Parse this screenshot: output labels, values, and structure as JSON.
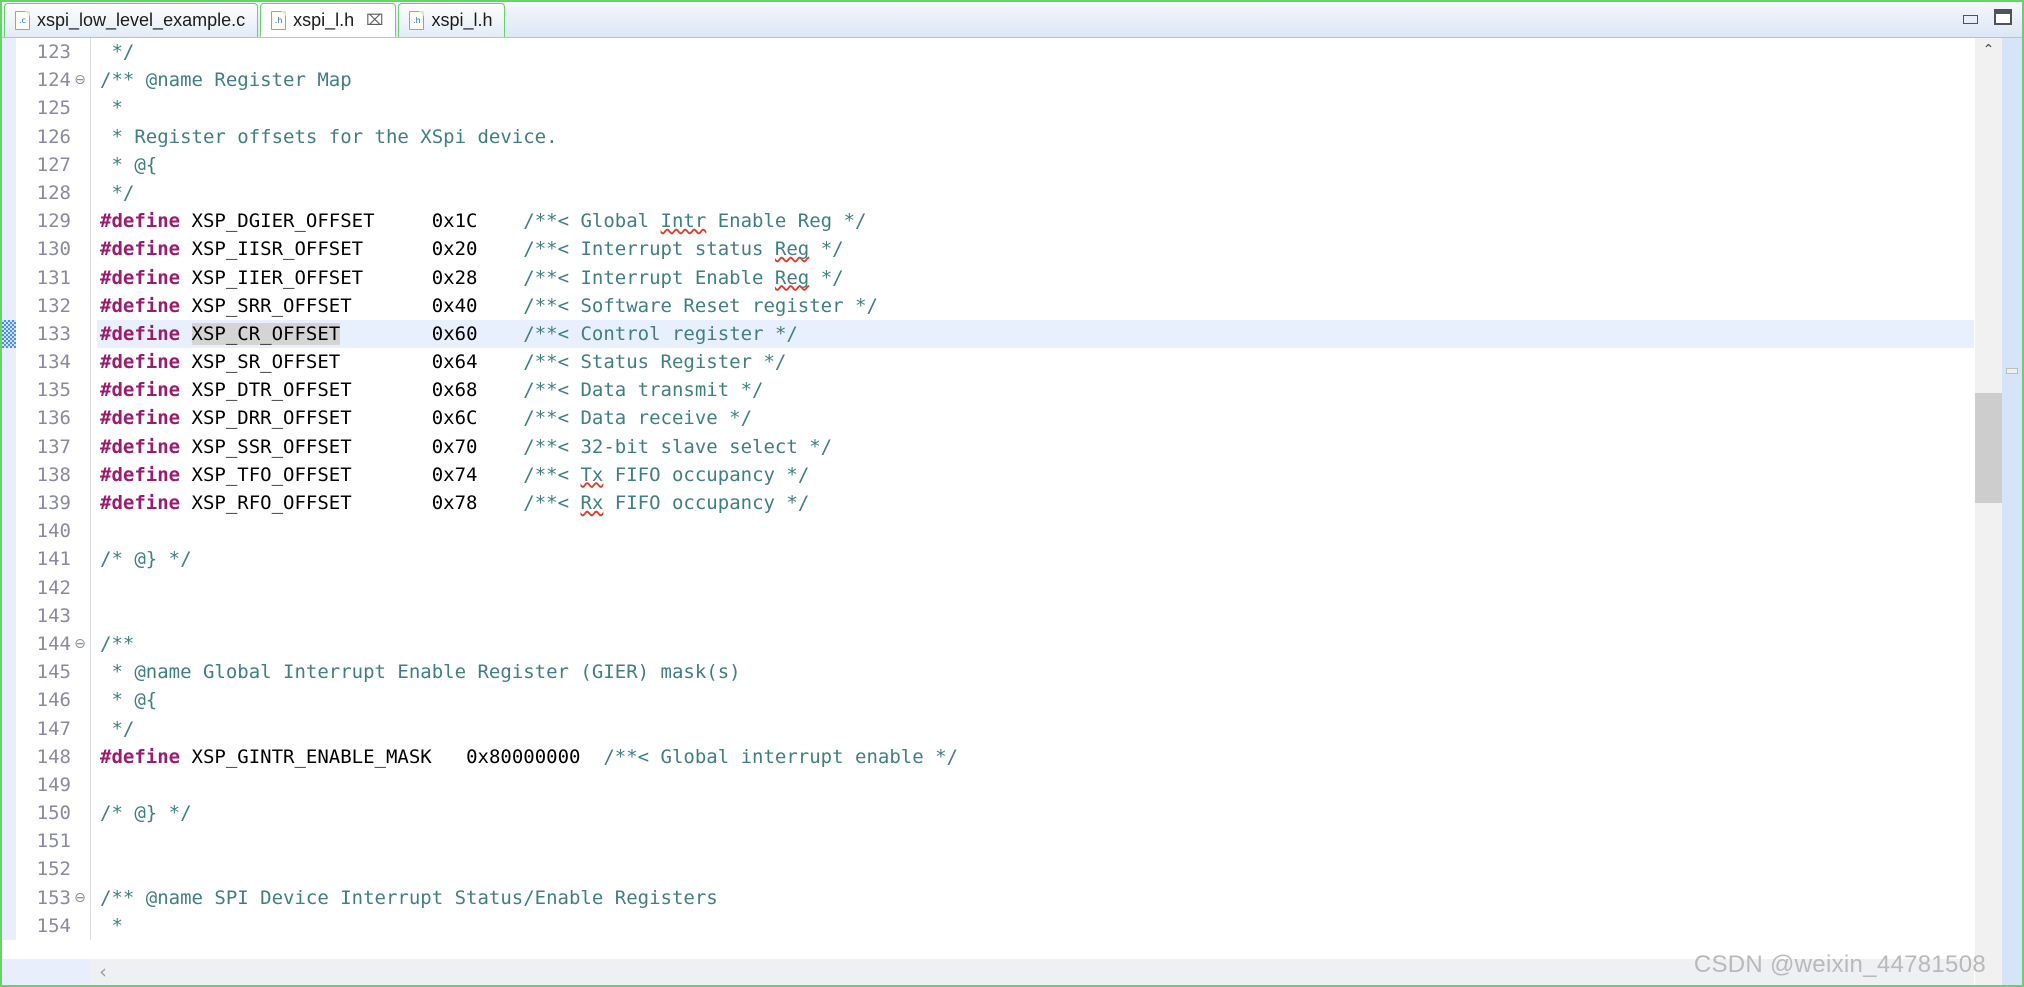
{
  "window": {
    "minimize_label": "Minimize",
    "maximize_label": "Maximize"
  },
  "tabs": [
    {
      "label": "xspi_low_level_example.c",
      "icon": "c-file-icon",
      "badge": ".c",
      "active": false,
      "closable": false
    },
    {
      "label": "xspi_l.h",
      "icon": "h-file-icon",
      "badge": ".h",
      "active": true,
      "closable": true,
      "close_glyph": "⌧"
    },
    {
      "label": "xspi_l.h",
      "icon": "h-file-icon",
      "badge": ".h",
      "active": false,
      "closable": false
    }
  ],
  "editor": {
    "current_line": 133,
    "first_line": 123,
    "scrollbar": {
      "up_arrow": "⌃",
      "left_arrow": "‹"
    },
    "lines": [
      {
        "n": "123",
        "fold": "",
        "segments": [
          {
            "t": " */",
            "c": "cmt"
          }
        ]
      },
      {
        "n": "124",
        "fold": "⊖",
        "segments": [
          {
            "t": "/** @name Register Map",
            "c": "cmt"
          }
        ]
      },
      {
        "n": "125",
        "fold": "",
        "segments": [
          {
            "t": " *",
            "c": "cmt"
          }
        ]
      },
      {
        "n": "126",
        "fold": "",
        "segments": [
          {
            "t": " * Register offsets for the XSpi device.",
            "c": "cmt"
          }
        ]
      },
      {
        "n": "127",
        "fold": "",
        "segments": [
          {
            "t": " * @{",
            "c": "cmt"
          }
        ]
      },
      {
        "n": "128",
        "fold": "",
        "segments": [
          {
            "t": " */",
            "c": "cmt"
          }
        ]
      },
      {
        "n": "129",
        "fold": "",
        "segments": [
          {
            "t": "#define",
            "c": "define"
          },
          {
            "t": " XSP_DGIER_OFFSET",
            "c": "ident"
          },
          {
            "t": "     0x1C",
            "c": "num"
          },
          {
            "t": "    /**< Global ",
            "c": "cmt"
          },
          {
            "t": "Intr",
            "c": "cmt-sq"
          },
          {
            "t": " Enable Reg */",
            "c": "cmt"
          }
        ]
      },
      {
        "n": "130",
        "fold": "",
        "segments": [
          {
            "t": "#define",
            "c": "define"
          },
          {
            "t": " XSP_IISR_OFFSET",
            "c": "ident"
          },
          {
            "t": "      0x20",
            "c": "num"
          },
          {
            "t": "    /**< Interrupt status ",
            "c": "cmt"
          },
          {
            "t": "Reg",
            "c": "cmt-sq"
          },
          {
            "t": " */",
            "c": "cmt"
          }
        ]
      },
      {
        "n": "131",
        "fold": "",
        "segments": [
          {
            "t": "#define",
            "c": "define"
          },
          {
            "t": " XSP_IIER_OFFSET",
            "c": "ident"
          },
          {
            "t": "      0x28",
            "c": "num"
          },
          {
            "t": "    /**< Interrupt Enable ",
            "c": "cmt"
          },
          {
            "t": "Reg",
            "c": "cmt-sq"
          },
          {
            "t": " */",
            "c": "cmt"
          }
        ]
      },
      {
        "n": "132",
        "fold": "",
        "segments": [
          {
            "t": "#define",
            "c": "define"
          },
          {
            "t": " XSP_SRR_OFFSET",
            "c": "ident"
          },
          {
            "t": "       0x40",
            "c": "num"
          },
          {
            "t": "    /**< Software Reset register */",
            "c": "cmt"
          }
        ]
      },
      {
        "n": "133",
        "fold": "",
        "current": true,
        "segments": [
          {
            "t": "#define",
            "c": "define"
          },
          {
            "t": " ",
            "c": "ident"
          },
          {
            "t": "XSP_CR_OFFSET",
            "c": "ident-occ"
          },
          {
            "t": "        0x60",
            "c": "num"
          },
          {
            "t": "    /**< Control register */",
            "c": "cmt"
          }
        ]
      },
      {
        "n": "134",
        "fold": "",
        "segments": [
          {
            "t": "#define",
            "c": "define"
          },
          {
            "t": " XSP_SR_OFFSET",
            "c": "ident"
          },
          {
            "t": "        0x64",
            "c": "num"
          },
          {
            "t": "    /**< Status Register */",
            "c": "cmt"
          }
        ]
      },
      {
        "n": "135",
        "fold": "",
        "segments": [
          {
            "t": "#define",
            "c": "define"
          },
          {
            "t": " XSP_DTR_OFFSET",
            "c": "ident"
          },
          {
            "t": "       0x68",
            "c": "num"
          },
          {
            "t": "    /**< Data transmit */",
            "c": "cmt"
          }
        ]
      },
      {
        "n": "136",
        "fold": "",
        "segments": [
          {
            "t": "#define",
            "c": "define"
          },
          {
            "t": " XSP_DRR_OFFSET",
            "c": "ident"
          },
          {
            "t": "       0x6C",
            "c": "num"
          },
          {
            "t": "    /**< Data receive */",
            "c": "cmt"
          }
        ]
      },
      {
        "n": "137",
        "fold": "",
        "segments": [
          {
            "t": "#define",
            "c": "define"
          },
          {
            "t": " XSP_SSR_OFFSET",
            "c": "ident"
          },
          {
            "t": "       0x70",
            "c": "num"
          },
          {
            "t": "    /**< 32-bit slave select */",
            "c": "cmt"
          }
        ]
      },
      {
        "n": "138",
        "fold": "",
        "segments": [
          {
            "t": "#define",
            "c": "define"
          },
          {
            "t": " XSP_TFO_OFFSET",
            "c": "ident"
          },
          {
            "t": "       0x74",
            "c": "num"
          },
          {
            "t": "    /**< ",
            "c": "cmt"
          },
          {
            "t": "Tx",
            "c": "cmt-sq"
          },
          {
            "t": " FIFO occupancy */",
            "c": "cmt"
          }
        ]
      },
      {
        "n": "139",
        "fold": "",
        "segments": [
          {
            "t": "#define",
            "c": "define"
          },
          {
            "t": " XSP_RFO_OFFSET",
            "c": "ident"
          },
          {
            "t": "       0x78",
            "c": "num"
          },
          {
            "t": "    /**< ",
            "c": "cmt"
          },
          {
            "t": "Rx",
            "c": "cmt-sq"
          },
          {
            "t": " FIFO occupancy */",
            "c": "cmt"
          }
        ]
      },
      {
        "n": "140",
        "fold": "",
        "segments": []
      },
      {
        "n": "141",
        "fold": "",
        "segments": [
          {
            "t": "/* @} */",
            "c": "cmt"
          }
        ]
      },
      {
        "n": "142",
        "fold": "",
        "segments": []
      },
      {
        "n": "143",
        "fold": "",
        "segments": []
      },
      {
        "n": "144",
        "fold": "⊖",
        "segments": [
          {
            "t": "/**",
            "c": "cmt"
          }
        ]
      },
      {
        "n": "145",
        "fold": "",
        "segments": [
          {
            "t": " * @name Global Interrupt Enable Register (GIER) mask(s)",
            "c": "cmt"
          }
        ]
      },
      {
        "n": "146",
        "fold": "",
        "segments": [
          {
            "t": " * @{",
            "c": "cmt"
          }
        ]
      },
      {
        "n": "147",
        "fold": "",
        "segments": [
          {
            "t": " */",
            "c": "cmt"
          }
        ]
      },
      {
        "n": "148",
        "fold": "",
        "segments": [
          {
            "t": "#define",
            "c": "define"
          },
          {
            "t": " XSP_GINTR_ENABLE_MASK",
            "c": "ident"
          },
          {
            "t": "   0x80000000",
            "c": "num"
          },
          {
            "t": "  /**< Global interrupt enable */",
            "c": "cmt"
          }
        ]
      },
      {
        "n": "149",
        "fold": "",
        "segments": []
      },
      {
        "n": "150",
        "fold": "",
        "segments": [
          {
            "t": "/* @} */",
            "c": "cmt"
          }
        ]
      },
      {
        "n": "151",
        "fold": "",
        "segments": []
      },
      {
        "n": "152",
        "fold": "",
        "segments": []
      },
      {
        "n": "153",
        "fold": "⊖",
        "segments": [
          {
            "t": "/** @name SPI Device Interrupt Status/Enable Registers",
            "c": "cmt"
          }
        ]
      },
      {
        "n": "154",
        "fold": "",
        "segments": [
          {
            "t": " *",
            "c": "cmt"
          }
        ]
      }
    ]
  },
  "watermark": {
    "text": "CSDN @weixin_44781508"
  },
  "colors": {
    "comment": "#3f7f7f",
    "preprocessor": "#9b1b6e",
    "current_line_bg": "#e8f0fe",
    "occurrence_bg": "#d4d4d4",
    "tab_border": "#67d267",
    "spell_error": "#e03c28"
  }
}
